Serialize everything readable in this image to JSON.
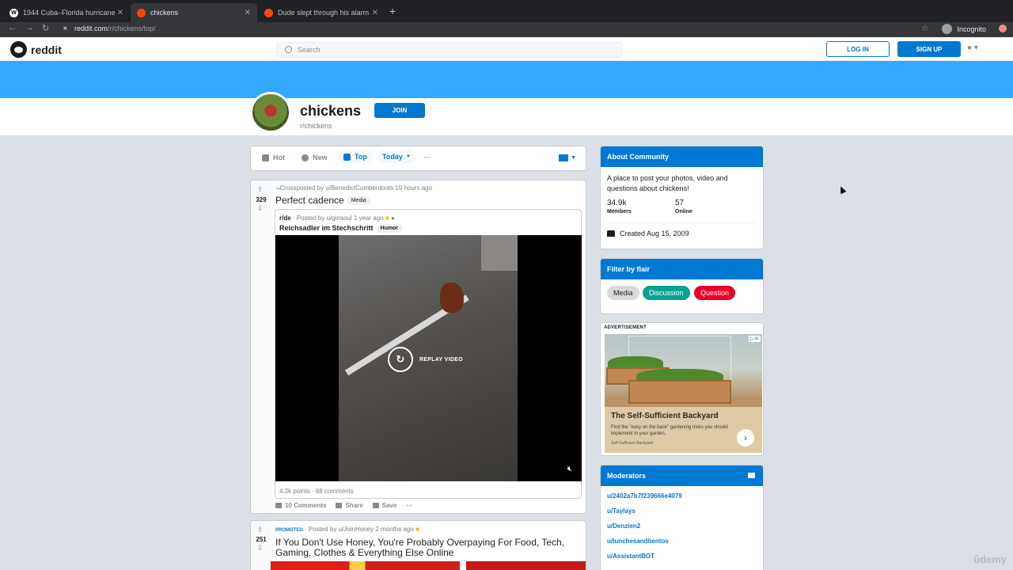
{
  "browser": {
    "tabs": [
      {
        "title": "1944 Cuba–Florida hurricane",
        "favicon": "W"
      },
      {
        "title": "chickens",
        "favicon": "reddit"
      },
      {
        "title": "Dude slept through his alarm",
        "favicon": "reddit"
      }
    ],
    "url_host": "reddit.com",
    "url_path": "/r/chickens/top/",
    "incognito_label": "Incognito"
  },
  "header": {
    "brand": "reddit",
    "search_placeholder": "Search",
    "login_label": "LOG IN",
    "signup_label": "SIGN UP"
  },
  "subreddit": {
    "name": "chickens",
    "path": "r/chickens",
    "join_label": "JOIN"
  },
  "sort": {
    "hot": "Hot",
    "new": "New",
    "top": "Top",
    "timeframe": "Today",
    "more": "···"
  },
  "post1": {
    "score": "329",
    "crosspost_meta": "Crossposted by u/BenedictCumberdoots 19 hours ago",
    "title": "Perfect cadence",
    "flair": "Media",
    "inner": {
      "subreddit": "r/de",
      "meta": "· Posted by u/ginsoul 1 year ago",
      "title": "Reichsadler im Stechschritt",
      "flair": "Humor",
      "replay_label": "REPLAY VIDEO",
      "stats": "4.2k points · 88 comments"
    },
    "actions": {
      "comments": "10 Comments",
      "share": "Share",
      "save": "Save",
      "more": "···"
    }
  },
  "post2": {
    "score": "251",
    "promoted": "PROMOTED",
    "meta": "· Posted by u/JoinHoney 2 months ago",
    "title": "If You Don't Use Honey, You're Probably Overpaying For Food, Tech, Gaming, Clothes & Everything Else Online"
  },
  "about": {
    "heading": "About Community",
    "description": "A place to post your photos, video and questions about chickens!",
    "members_value": "34.9k",
    "members_label": "Members",
    "online_value": "57",
    "online_label": "Online",
    "created": "Created Aug 15, 2009"
  },
  "flair_filter": {
    "heading": "Filter by flair",
    "flairs": [
      {
        "label": "Media",
        "color": "#dadada"
      },
      {
        "label": "Discussion",
        "color": "#0aa18f"
      },
      {
        "label": "Question",
        "color": "#ea0027"
      }
    ]
  },
  "ad": {
    "label": "ADVERTISEMENT",
    "title": "The Self-Sufficient Backyard",
    "subtitle": "Find the \"easy on the back\" gardening tricks you should implement in your garden.",
    "source": "Self-Sufficient Backyard"
  },
  "moderators": {
    "heading": "Moderators",
    "list": [
      "u/2402a7b7f239666e4079",
      "u/Taylays",
      "u/Denzien2",
      "u/lunchesandbentos",
      "u/AssistantBOT"
    ]
  },
  "watermark": "ûdemy",
  "colors": {
    "accent": "#0079d3",
    "banner": "#33a8ff"
  }
}
